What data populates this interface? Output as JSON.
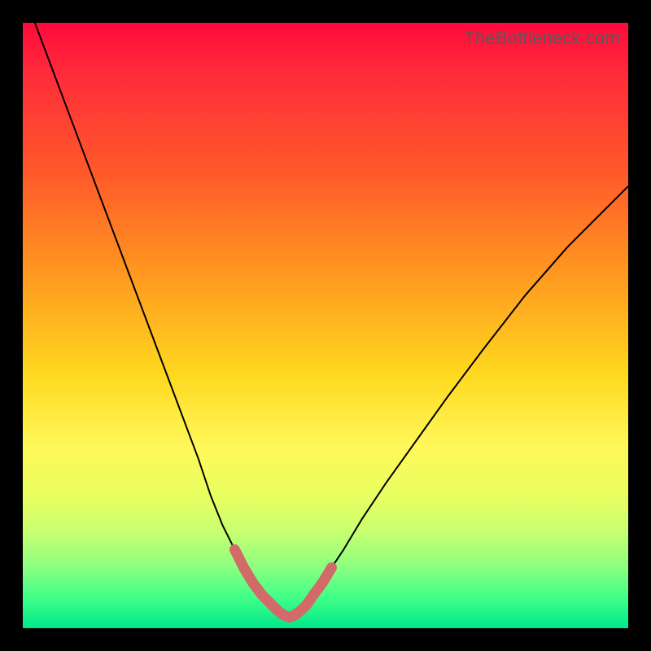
{
  "watermark": "TheBottleneck.com",
  "chart_data": {
    "type": "line",
    "title": "",
    "xlabel": "",
    "ylabel": "",
    "xlim": [
      0,
      100
    ],
    "ylim": [
      0,
      100
    ],
    "grid": false,
    "series": [
      {
        "name": "bottleneck-curve",
        "stroke": "#000000",
        "stroke_width": 2,
        "x": [
          2,
          5,
          8,
          11,
          14,
          17,
          20,
          23,
          26,
          29,
          31,
          33,
          35,
          36.5,
          38,
          39.5,
          41,
          42,
          43,
          44
        ],
        "values": [
          100,
          92,
          84,
          76,
          68,
          60,
          52,
          44,
          36,
          28,
          22,
          17,
          13,
          10,
          7.5,
          5.5,
          4,
          3,
          2.2,
          1.8
        ]
      },
      {
        "name": "bottleneck-right",
        "stroke": "#000000",
        "stroke_width": 2,
        "x": [
          44,
          45,
          46,
          47,
          48,
          49.5,
          51,
          53,
          56,
          60,
          65,
          70,
          76,
          83,
          90,
          96,
          100
        ],
        "values": [
          1.8,
          2.2,
          3,
          4,
          5.5,
          7.5,
          10,
          13,
          18,
          24,
          31,
          38,
          46,
          55,
          63,
          69,
          73
        ]
      },
      {
        "name": "highlight-min",
        "stroke": "#d36a6a",
        "stroke_width": 13,
        "linecap": "round",
        "x": [
          35,
          36.5,
          38,
          39.5,
          41,
          42,
          43,
          44,
          45,
          46,
          47,
          48,
          49.5,
          51
        ],
        "values": [
          13,
          10,
          7.5,
          5.5,
          4,
          3,
          2.2,
          1.8,
          2.2,
          3,
          4,
          5.5,
          7.5,
          10
        ]
      }
    ],
    "background_gradient": {
      "top_color": "#ff0a3c",
      "bottom_color": "#00e88c",
      "stops": [
        "#ff0a3c",
        "#ff5a2a",
        "#ffd81f",
        "#fff85a",
        "#8aff80",
        "#00e88c"
      ]
    }
  }
}
